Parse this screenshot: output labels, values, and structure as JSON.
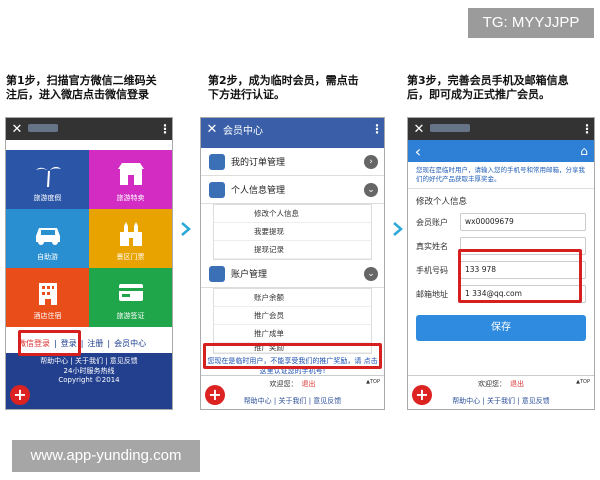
{
  "watermark_top": "TG: MYYJJPP",
  "watermark_bottom": "www.app-yunding.com",
  "steps": [
    {
      "line1": "第1步，扫描官方微信二维码关",
      "line2": "注后，进入微店点击微信登录"
    },
    {
      "line1": "第2步，成为临时会员，需点击",
      "line2": "下方进行认证。"
    },
    {
      "line1": "第3步，完善会员手机及邮箱信息",
      "line2": "后，即可成为正式推广会员。"
    }
  ],
  "phone1": {
    "close": "✕",
    "menu": "⋮",
    "tiles": [
      "旅游度假",
      "旅游特卖",
      "自助游",
      "景区门票",
      "酒店住宿",
      "旅游签证"
    ],
    "tile_colors": [
      "#2b56a8",
      "#d32cc2",
      "#2a8fd0",
      "#e8a300",
      "#e84d1a",
      "#1fa64a"
    ],
    "login_bar": [
      "微信登录",
      "登录",
      "注册",
      "会员中心"
    ],
    "footer_links": "帮助中心 | 关于我们 | 意见反馈",
    "footer_line2": "24小时服务热线",
    "copyright": "Copyright ©2014"
  },
  "phone2": {
    "title": "会员中心",
    "close": "✕",
    "menu": "⋮",
    "sections": [
      {
        "label": "我的订单管理"
      },
      {
        "label": "个人信息管理",
        "items": [
          "修改个人信息",
          "我要提现",
          "提现记录"
        ]
      },
      {
        "label": "账户管理",
        "items": [
          "账户余额",
          "推广会员",
          "推广成单",
          "推广奖励"
        ]
      }
    ],
    "notice": "您现在是临时用户，不能享受我们的推广奖励，请 点击这里认证您的手机号!",
    "welcome": "欢迎您：",
    "logout": "退出",
    "top": "▲TOP",
    "footer_links": "帮助中心 | 关于我们 | 意见反馈"
  },
  "phone3": {
    "close": "✕",
    "menu": "⋮",
    "back": "‹",
    "home": "⌂",
    "intro": "您现在是临时用户，请输入您的手机号和常用邮箱，分享我们的好代产品获取丰厚奖金。",
    "section_title": "修改个人信息",
    "fields": [
      {
        "label": "会员账户",
        "value": "wx00009679"
      },
      {
        "label": "真实姓名",
        "value": ""
      },
      {
        "label": "手机号码",
        "value": "133      978"
      },
      {
        "label": "邮箱地址",
        "value": "1      334@qq.com"
      }
    ],
    "save": "保存",
    "welcome": "欢迎您：",
    "logout": "退出",
    "top": "▲TOP",
    "footer_links": "帮助中心 | 关于我们 | 意见反馈"
  },
  "accent": "#d62020"
}
